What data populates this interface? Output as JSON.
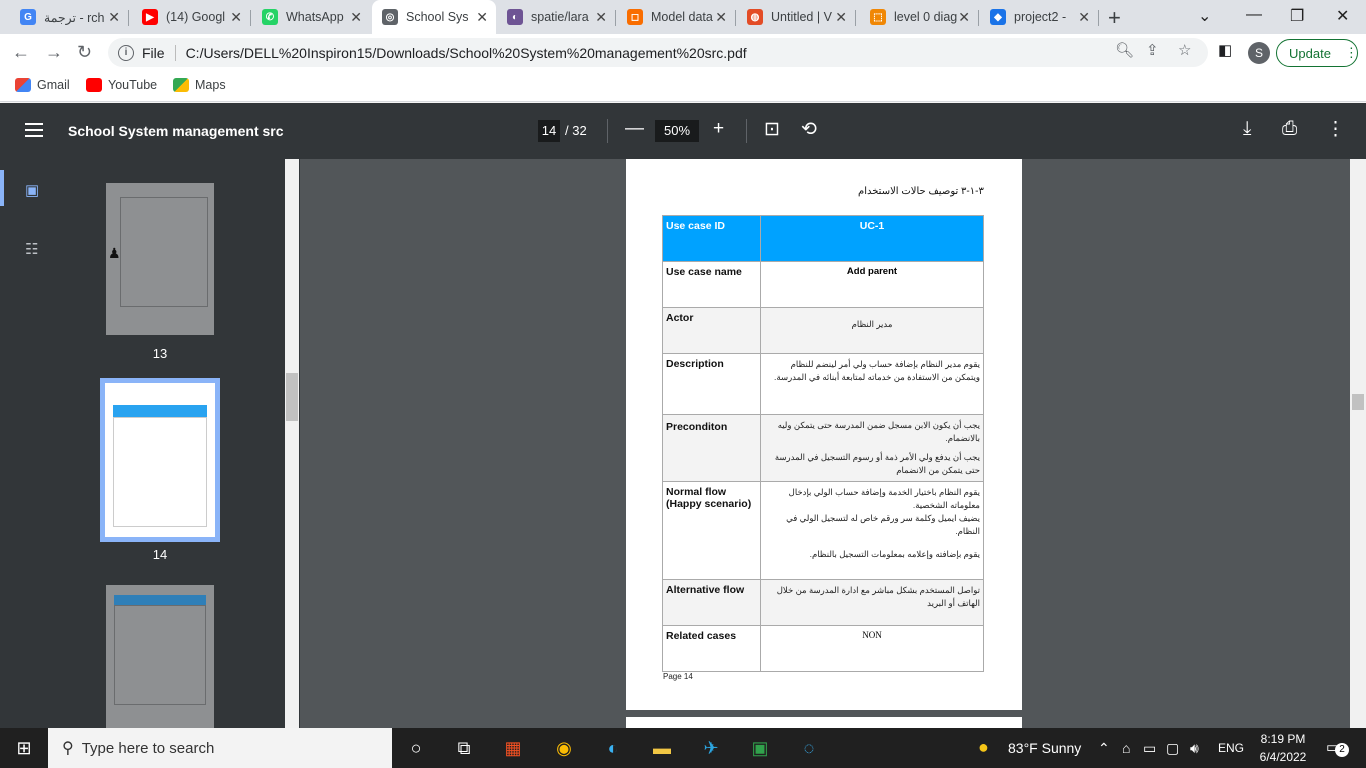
{
  "tabs": [
    {
      "title": "ترجمة - rch",
      "favicon": "G",
      "color": "#4285f4"
    },
    {
      "title": "(14) Googl",
      "favicon": "▶",
      "color": "#ff0000"
    },
    {
      "title": "WhatsApp",
      "favicon": "✆",
      "color": "#25d366"
    },
    {
      "title": "School Sys",
      "favicon": "◎",
      "color": "#5f6368"
    },
    {
      "title": "spatie/lara",
      "favicon": "◐",
      "color": "#6e5494"
    },
    {
      "title": "Model data",
      "favicon": "◻",
      "color": "#f96d00"
    },
    {
      "title": "Untitled | V",
      "favicon": "◍",
      "color": "#e34c26"
    },
    {
      "title": "level 0 diag",
      "favicon": "⬚",
      "color": "#f08705"
    },
    {
      "title": "project2 -",
      "favicon": "◆",
      "color": "#1a73e8"
    }
  ],
  "address": {
    "info_label": "File",
    "url": "C:/Users/DELL%20Inspiron15/Downloads/School%20System%20management%20src.pdf"
  },
  "profile_initial": "S",
  "update_label": "Update",
  "bookmarks": [
    {
      "label": "Gmail"
    },
    {
      "label": "YouTube"
    },
    {
      "label": "Maps"
    }
  ],
  "pdf": {
    "title": "School System management src",
    "page": "14",
    "total": "/ 32",
    "zoom": "50%"
  },
  "thumbnails": [
    {
      "num": "13"
    },
    {
      "num": "14"
    }
  ],
  "doc": {
    "section_title": "٣-١-٣ توصيف حالات الاستخدام",
    "rows": [
      {
        "label": "Use case ID",
        "value": "UC-1"
      },
      {
        "label": "Use case name",
        "value": "Add parent"
      },
      {
        "label": "Actor",
        "value": "مدير النظام"
      },
      {
        "label": "Description",
        "value": "يقوم مدير النظام بإضافة حساب ولي أمر لينضم للنظام ويتمكن من الاستفادة من خدماته لمتابعة أبنائه في المدرسة."
      },
      {
        "label": "Preconditon",
        "value1": "يجب أن يكون الابن مسجل ضمن المدرسة حتى يتمكن وليه بالانضمام.",
        "value2": "يجب أن يدفع ولي الأمر ذمة أو رسوم التسجيل في المدرسة حتى يتمكن من الانضمام"
      },
      {
        "label": "Normal flow (Happy scenario)",
        "value1": "يقوم النظام باختيار الخدمة وإضافة حساب الولي بإدخال معلوماته الشخصية.",
        "value2": "يضيف ايميل وكلمة سر ورقم خاص له لتسجيل الولي في النظام.",
        "value3": "يقوم بإضافته وإعلامه بمعلومات التسجيل بالنظام."
      },
      {
        "label": "Alternative flow",
        "value": "تواصل المستخدم بشكل مباشر مع ادارة المدرسة من خلال الهاتف أو البريد"
      },
      {
        "label": "Related cases",
        "value": "NON"
      }
    ],
    "page_label": "Page 14"
  },
  "taskbar": {
    "search_placeholder": "Type here to search",
    "weather": "83°F  Sunny",
    "lang": "ENG",
    "time": "8:19 PM",
    "date": "6/4/2022",
    "notif": "2"
  }
}
